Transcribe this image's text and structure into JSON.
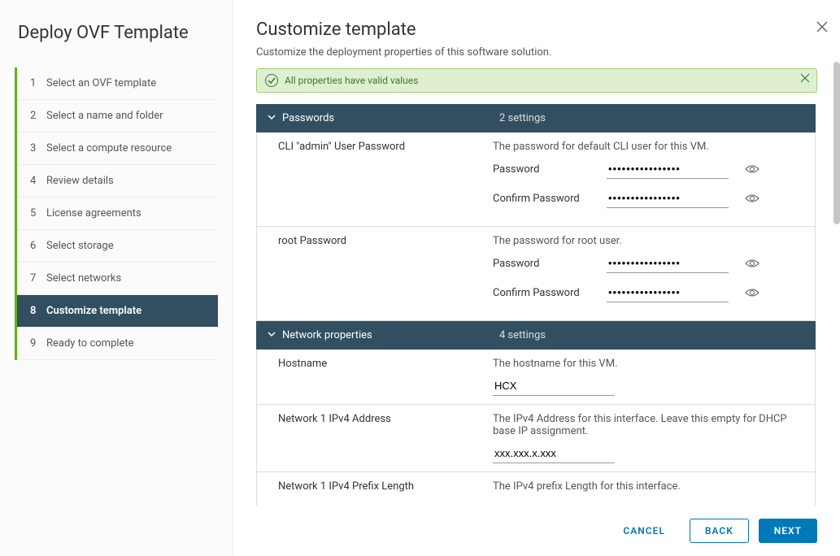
{
  "dialog": {
    "title": "Deploy OVF Template"
  },
  "steps": [
    {
      "num": "1",
      "label": "Select an OVF template",
      "active": false
    },
    {
      "num": "2",
      "label": "Select a name and folder",
      "active": false
    },
    {
      "num": "3",
      "label": "Select a compute resource",
      "active": false
    },
    {
      "num": "4",
      "label": "Review details",
      "active": false
    },
    {
      "num": "5",
      "label": "License agreements",
      "active": false
    },
    {
      "num": "6",
      "label": "Select storage",
      "active": false
    },
    {
      "num": "7",
      "label": "Select networks",
      "active": false
    },
    {
      "num": "8",
      "label": "Customize template",
      "active": true
    },
    {
      "num": "9",
      "label": "Ready to complete",
      "active": false
    }
  ],
  "page": {
    "title": "Customize template",
    "subtitle": "Customize the deployment properties of this software solution."
  },
  "banner": {
    "text": "All properties have valid values"
  },
  "sections": {
    "passwords": {
      "title": "Passwords",
      "count": "2 settings",
      "fields": {
        "cli_admin": {
          "label": "CLI \"admin\" User Password",
          "desc": "The password for default CLI user for this VM.",
          "password_label": "Password",
          "confirm_label": "Confirm Password",
          "value": "••••••••••••••••",
          "confirm_value": "••••••••••••••••"
        },
        "root": {
          "label": "root Password",
          "desc": "The password for root user.",
          "password_label": "Password",
          "confirm_label": "Confirm Password",
          "value": "••••••••••••••••",
          "confirm_value": "••••••••••••••••"
        }
      }
    },
    "network": {
      "title": "Network properties",
      "count": "4 settings",
      "fields": {
        "hostname": {
          "label": "Hostname",
          "desc": "The hostname for this VM.",
          "value": "HCX"
        },
        "ipv4_address": {
          "label": "Network 1 IPv4 Address",
          "desc": "The IPv4 Address for this interface. Leave this empty for DHCP base IP assignment.",
          "value": "xxx.xxx.x.xxx"
        },
        "ipv4_prefix": {
          "label": "Network 1 IPv4 Prefix Length",
          "desc": "The IPv4 prefix Length for this interface."
        }
      }
    }
  },
  "footer": {
    "cancel": "CANCEL",
    "back": "BACK",
    "next": "NEXT"
  }
}
